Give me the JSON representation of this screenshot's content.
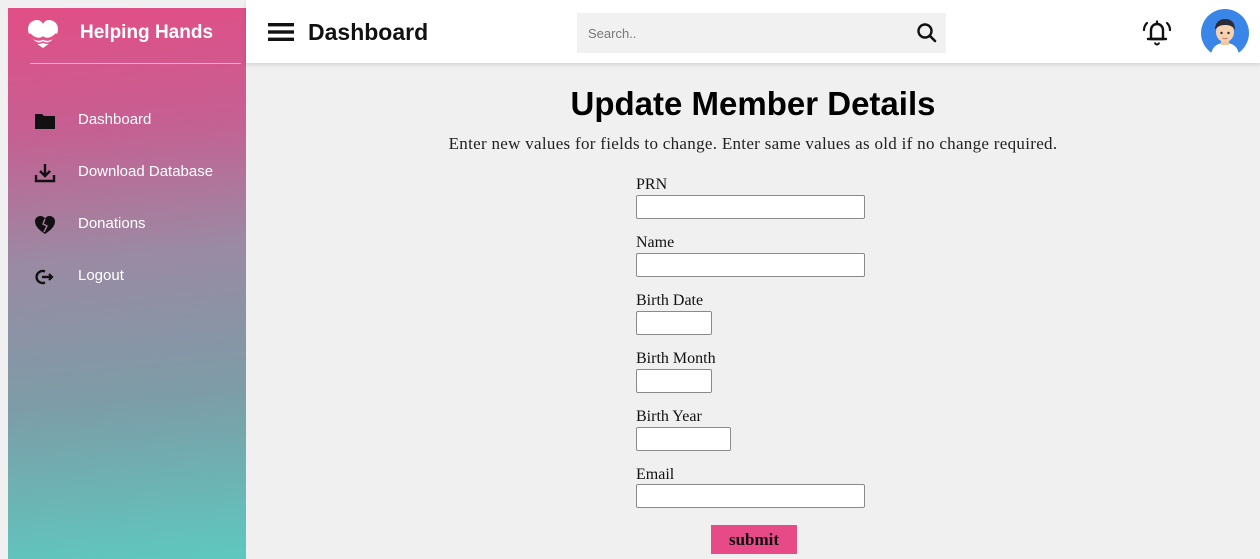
{
  "brand": {
    "name": "Helping Hands",
    "logo_icon": "heart-hands-icon"
  },
  "sidebar": {
    "items": [
      {
        "label": "Dashboard",
        "icon": "folder-icon"
      },
      {
        "label": "Download Database",
        "icon": "download-icon"
      },
      {
        "label": "Donations",
        "icon": "broken-heart-icon"
      },
      {
        "label": "Logout",
        "icon": "logout-icon"
      }
    ]
  },
  "topbar": {
    "title": "Dashboard",
    "search_placeholder": "Search..",
    "icons": [
      "menu-icon",
      "search-icon",
      "bell-icon",
      "avatar"
    ]
  },
  "form": {
    "title": "Update Member Details",
    "subtitle": "Enter new values for fields to change. Enter same values as old if no change required.",
    "fields": [
      {
        "label": "PRN",
        "value": ""
      },
      {
        "label": "Name",
        "value": ""
      },
      {
        "label": "Birth Date",
        "value": ""
      },
      {
        "label": "Birth Month",
        "value": ""
      },
      {
        "label": "Birth Year",
        "value": ""
      },
      {
        "label": "Email",
        "value": ""
      }
    ],
    "submit_label": "submit"
  },
  "colors": {
    "sidebar_top": "#e24e86",
    "sidebar_bottom": "#5ec8bf",
    "submit_button": "#e84a87",
    "avatar_bg": "#3a86e8"
  }
}
